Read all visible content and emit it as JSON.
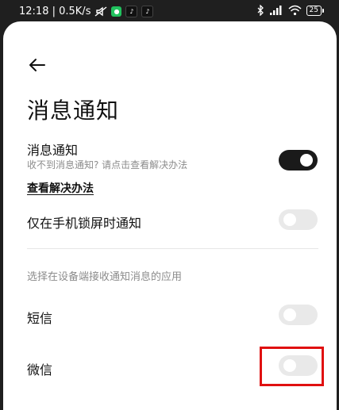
{
  "statusbar": {
    "time_speed": "12:18 | 0.5K/s",
    "battery": "25"
  },
  "page": {
    "title": "消息通知"
  },
  "notifications": {
    "label": "消息通知",
    "subtitle": "收不到消息通知? 请点击查看解决办法",
    "link": "查看解决办法",
    "enabled": true
  },
  "lock_only": {
    "label": "仅在手机锁屏时通知",
    "enabled": false
  },
  "apps_section": {
    "title": "选择在设备端接收通知消息的应用",
    "items": [
      {
        "label": "短信",
        "enabled": false
      },
      {
        "label": "微信",
        "enabled": false
      }
    ]
  },
  "colors": {
    "toggle_on": "#1a1a1a",
    "toggle_off": "#e9e9e9",
    "highlight": "#e01010"
  }
}
